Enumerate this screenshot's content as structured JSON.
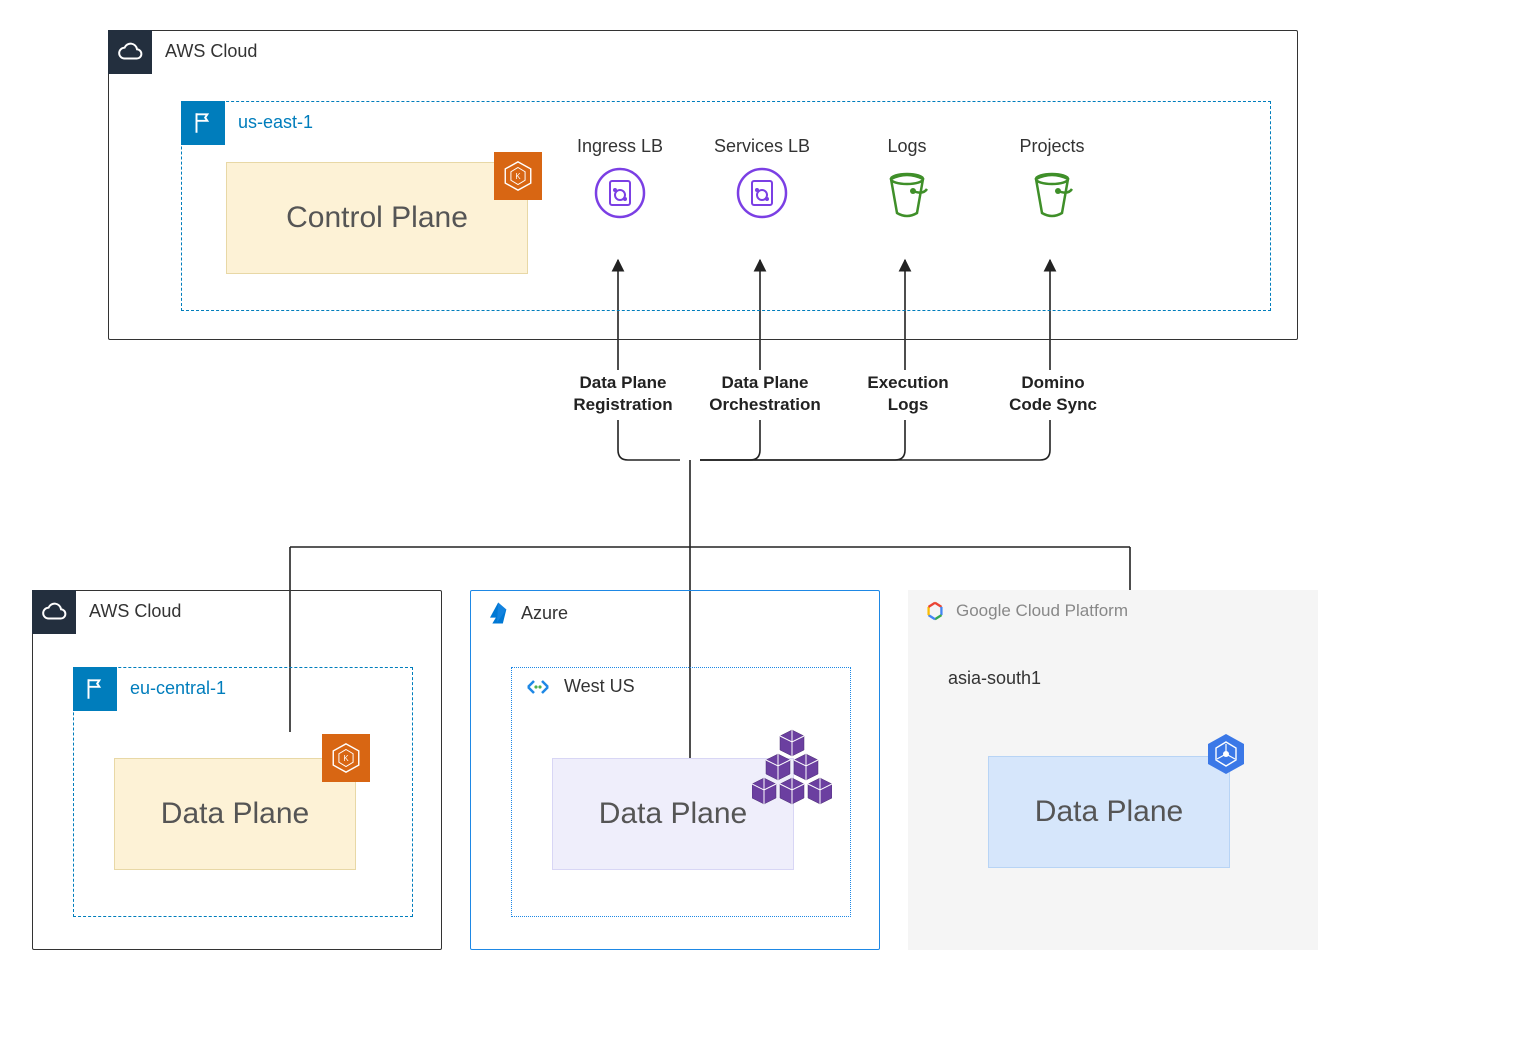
{
  "top_cloud": {
    "provider_label": "AWS Cloud",
    "region_label": "us-east-1",
    "control_plane_label": "Control Plane",
    "services": {
      "ingress": {
        "label": "Ingress LB"
      },
      "services_lb": {
        "label": "Services LB"
      },
      "logs": {
        "label": "Logs"
      },
      "projects": {
        "label": "Projects"
      }
    }
  },
  "connections": {
    "registration": "Data Plane\nRegistration",
    "orchestration": "Data Plane\nOrchestration",
    "exec_logs": "Execution\nLogs",
    "code_sync": "Domino\nCode Sync"
  },
  "bottom": {
    "aws": {
      "provider_label": "AWS Cloud",
      "region_label": "eu-central-1",
      "plane_label": "Data Plane"
    },
    "azure": {
      "provider_label": "Azure",
      "region_label": "West US",
      "plane_label": "Data Plane"
    },
    "gcp": {
      "provider_label": "Google Cloud Platform",
      "region_label": "asia-south1",
      "plane_label": "Data Plane"
    }
  }
}
